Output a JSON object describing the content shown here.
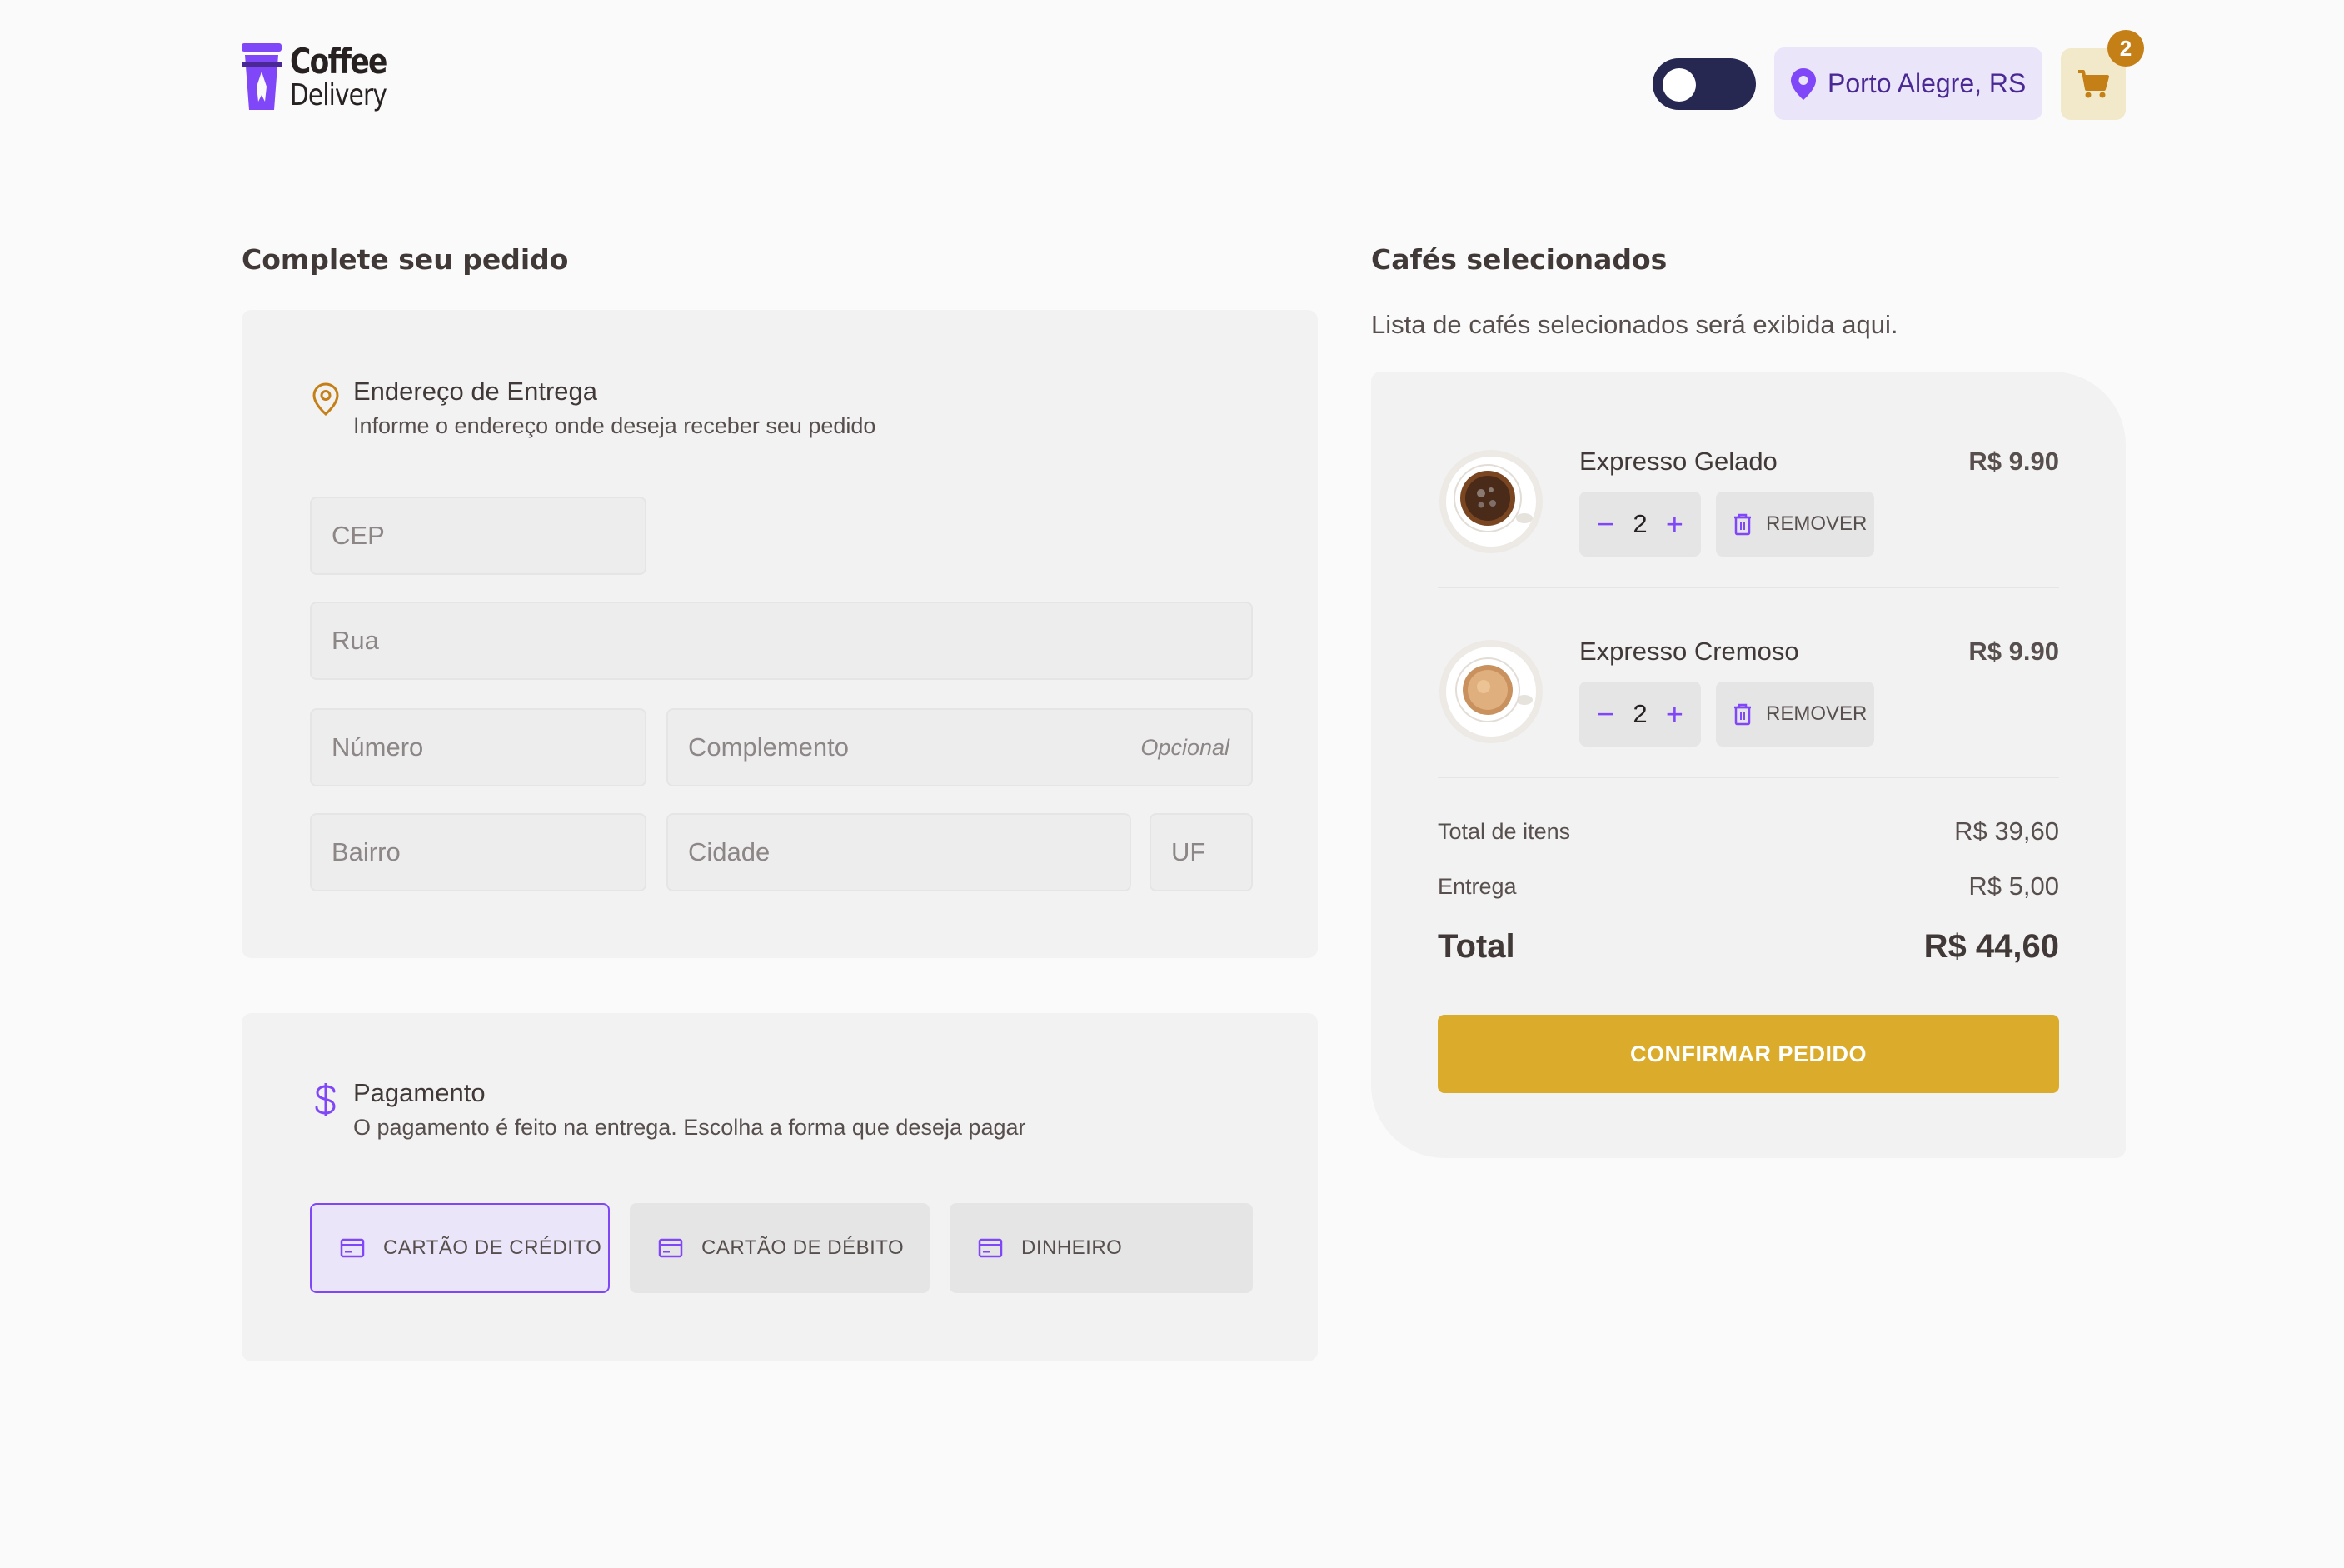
{
  "header": {
    "logo_line1": "Coffee",
    "logo_line2": "Delivery",
    "location": "Porto Alegre, RS",
    "cart_count": "2",
    "theme_toggle_state": "dark"
  },
  "order_form": {
    "title": "Complete seu pedido",
    "address": {
      "title": "Endereço de Entrega",
      "subtitle": "Informe o endereço onde deseja receber seu pedido",
      "fields": {
        "cep": "CEP",
        "rua": "Rua",
        "numero": "Número",
        "complemento": "Complemento",
        "complemento_hint": "Opcional",
        "bairro": "Bairro",
        "cidade": "Cidade",
        "uf": "UF"
      }
    },
    "payment": {
      "title": "Pagamento",
      "subtitle": "O pagamento é feito na entrega. Escolha a forma que deseja pagar",
      "options": [
        "CARTÃO DE CRÉDITO",
        "CARTÃO DE DÉBITO",
        "DINHEIRO"
      ],
      "selected": "CARTÃO DE CRÉDITO"
    }
  },
  "cart": {
    "title": "Cafés selecionados",
    "subtitle": "Lista de cafés selecionados será exibida aqui.",
    "items": [
      {
        "name": "Expresso Gelado",
        "price": "R$ 9.90",
        "quantity": "2",
        "remove_label": "REMOVER"
      },
      {
        "name": "Expresso Cremoso",
        "price": "R$ 9.90",
        "quantity": "2",
        "remove_label": "REMOVER"
      }
    ],
    "summary": {
      "items_label": "Total de itens",
      "items_value": "R$ 39,60",
      "delivery_label": "Entrega",
      "delivery_value": "R$ 5,00",
      "total_label": "Total",
      "total_value": "R$ 44,60"
    },
    "confirm_label": "CONFIRMAR PEDIDO"
  },
  "colors": {
    "purple": "#8047F8",
    "purple_dark": "#4B2995",
    "purple_light": "#EBE5F9",
    "yellow": "#DBAC2C",
    "yellow_dark": "#C47F17",
    "yellow_light": "#F1E9C9",
    "navy": "#272852"
  }
}
